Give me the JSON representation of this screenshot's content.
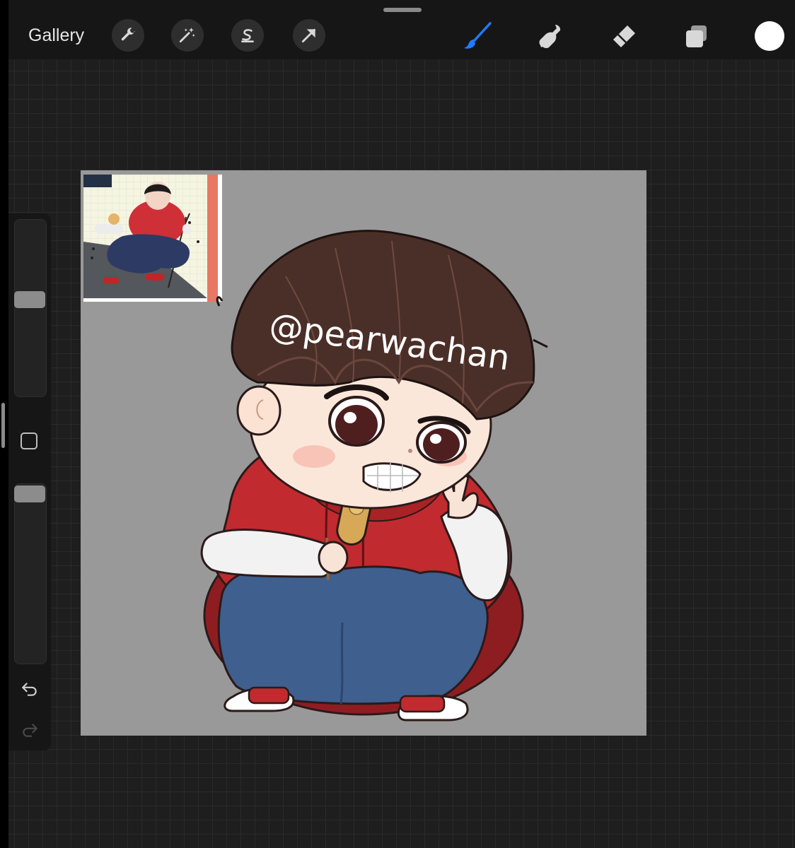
{
  "toolbar": {
    "gallery_label": "Gallery",
    "left_tools": [
      "wrench-icon",
      "magic-wand-icon",
      "selection-icon",
      "transform-arrow-icon"
    ],
    "right_tools": [
      "brush-icon",
      "smudge-icon",
      "eraser-icon",
      "layers-icon"
    ],
    "active_tool": "brush-icon",
    "accent_color": "#1f7bff",
    "current_color": "#ffffff"
  },
  "sidebar": {
    "brush_size": 0.55,
    "brush_opacity": 0.02,
    "undo_icon": "undo-icon",
    "redo_icon": "redo-icon"
  },
  "canvas": {
    "background_color": "#999999",
    "watermark": "@pearwachan"
  }
}
